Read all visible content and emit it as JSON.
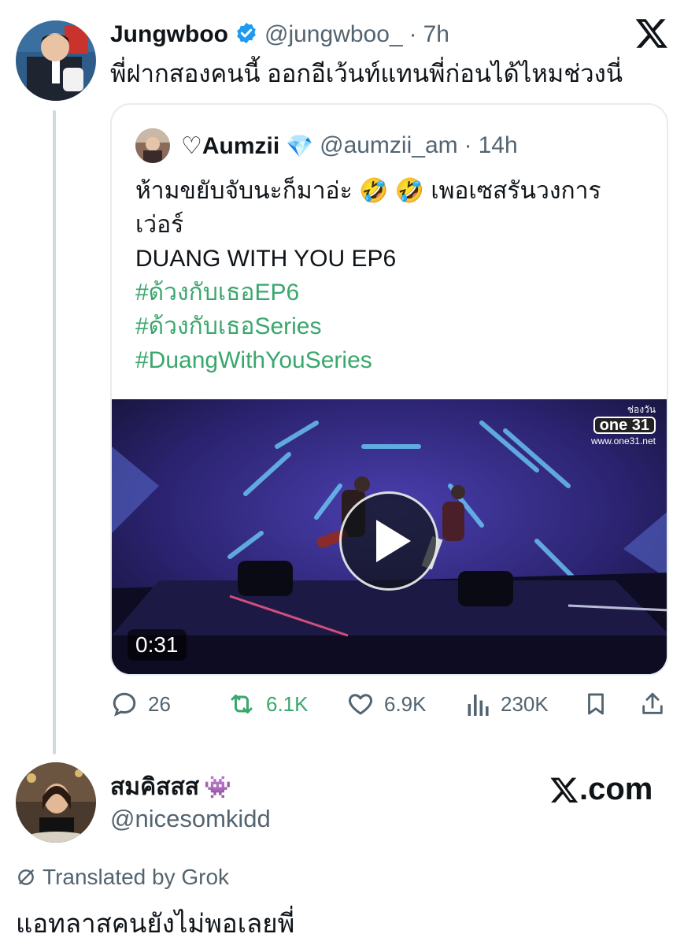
{
  "tweet": {
    "author_name": "Jungwboo",
    "verified": true,
    "handle": "@jungwboo_",
    "separator": "·",
    "time": "7h",
    "text": "พี่ฝากสองคนนี้ ออกอีเว้นท์แทนพี่ก่อนได้ไหมช่วงนี่"
  },
  "quote": {
    "author_name": "♡Aumzii",
    "author_emoji": "💎",
    "handle": "@aumzii_am",
    "separator": "·",
    "time": "14h",
    "text_line1": "ห้ามขยับจับนะก็มาอ่ะ 🤣 🤣 เพอเซสรันวงการ",
    "text_line2": "เว่อร์",
    "text_line3": "DUANG WITH YOU EP6",
    "hashtags": [
      "#ด้วงกับเธอEP6",
      "#ด้วงกับเธอSeries",
      "#DuangWithYouSeries"
    ],
    "video": {
      "duration": "0:31",
      "channel_top": "ช่องวัน",
      "channel_badge": "one 31",
      "channel_url": "www.one31.net"
    }
  },
  "actions": {
    "replies": "26",
    "reposts": "6.1K",
    "likes": "6.9K",
    "views": "230K"
  },
  "reply": {
    "author_name": "สมคิสสส",
    "author_emoji": "👾",
    "handle": "@nicesomkidd",
    "translated_label": "Translated by Grok",
    "text": "แอทลาสคนยังไม่พอเลยพี่"
  },
  "watermark": ".com",
  "colors": {
    "accent_green": "#3aa76d",
    "secondary_text": "#536471",
    "verified_blue": "#1d9bf0",
    "border": "#e6ecf0"
  }
}
